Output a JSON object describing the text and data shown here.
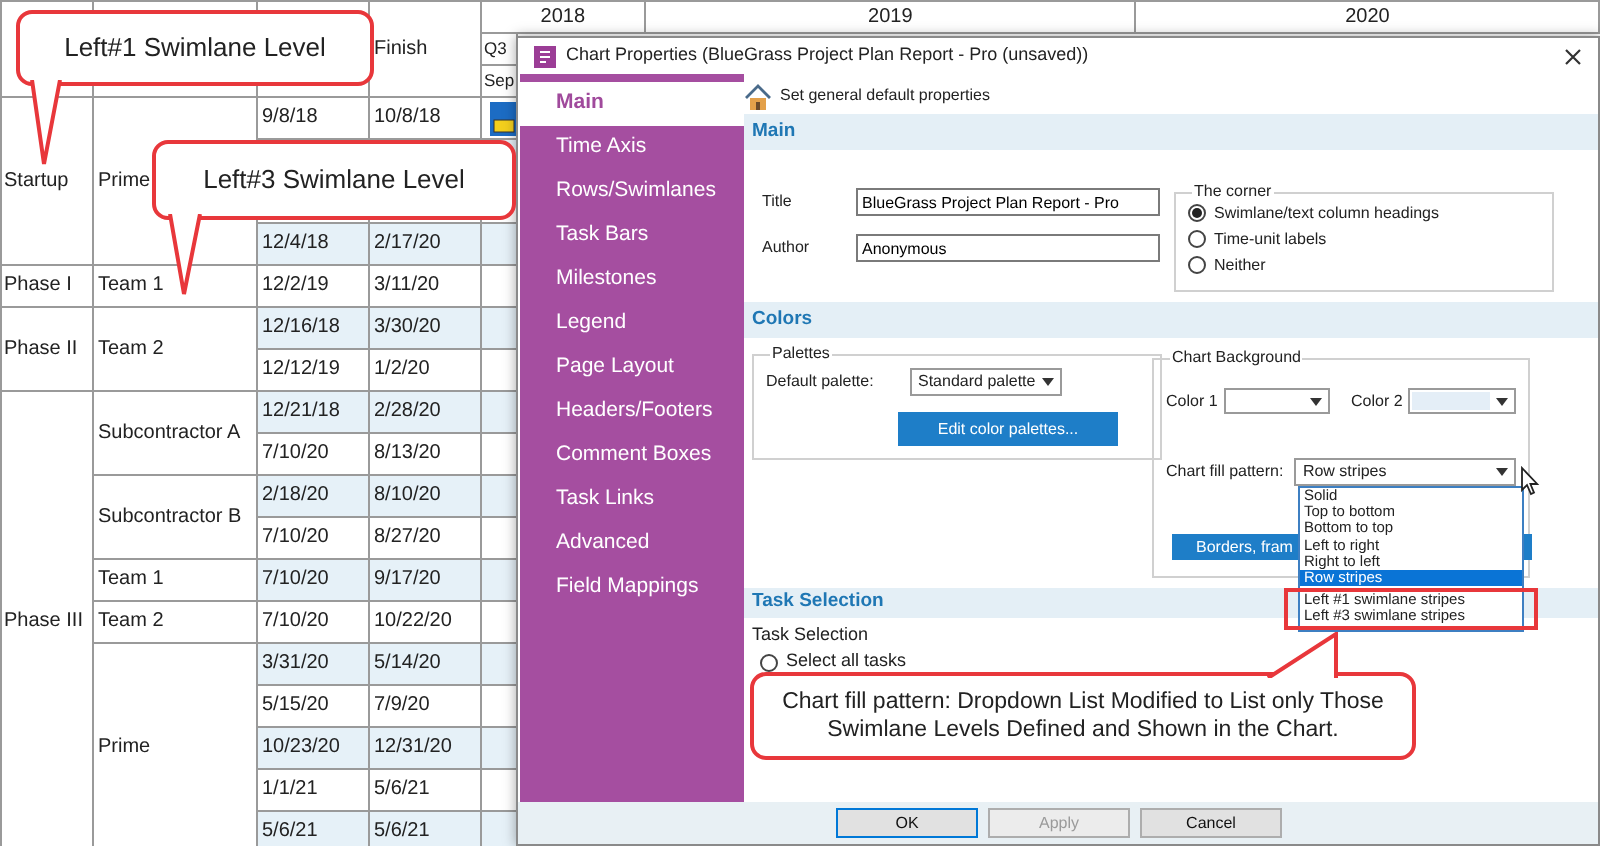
{
  "gantt": {
    "headings": {
      "finish": "Finish"
    },
    "timeline": {
      "years": [
        "2018",
        "2019",
        "2020"
      ],
      "quarters": [
        "Q3"
      ],
      "months": [
        "Sep"
      ]
    },
    "lanes": [
      {
        "label": "Startup",
        "groups": [
          {
            "label": "Prime",
            "tasks": [
              {
                "kind": "task",
                "start": "9/8/18",
                "finish": "10/8/18",
                "bar": true
              },
              {
                "kind": "covered"
              },
              {
                "kind": "covered"
              },
              {
                "kind": "task",
                "start": "12/4/18",
                "finish": "2/17/20"
              }
            ]
          }
        ]
      },
      {
        "label": "Phase I",
        "groups": [
          {
            "label": "Team 1",
            "tasks": [
              {
                "kind": "task",
                "start": "12/2/19",
                "finish": "3/11/20"
              }
            ]
          }
        ]
      },
      {
        "label": "Phase II",
        "groups": [
          {
            "label": "Team 2",
            "tasks": [
              {
                "kind": "task",
                "start": "12/16/18",
                "finish": "3/30/20"
              },
              {
                "kind": "task",
                "start": "12/12/19",
                "finish": "1/2/20"
              }
            ]
          }
        ]
      },
      {
        "label": "Phase III",
        "groups": [
          {
            "label": "Subcontractor A",
            "tasks": [
              {
                "kind": "task",
                "start": "12/21/18",
                "finish": "2/28/20"
              },
              {
                "kind": "task",
                "start": "7/10/20",
                "finish": "8/13/20"
              }
            ]
          },
          {
            "label": "Subcontractor B",
            "tasks": [
              {
                "kind": "task",
                "start": "2/18/20",
                "finish": "8/10/20"
              },
              {
                "kind": "task",
                "start": "7/10/20",
                "finish": "8/27/20"
              }
            ]
          },
          {
            "label": "Team 1",
            "tasks": [
              {
                "kind": "task",
                "start": "7/10/20",
                "finish": "9/17/20"
              }
            ]
          },
          {
            "label": "Team 2",
            "tasks": [
              {
                "kind": "task",
                "start": "7/10/20",
                "finish": "10/22/20"
              }
            ]
          },
          {
            "label": "Prime",
            "tasks": [
              {
                "kind": "task",
                "start": "3/31/20",
                "finish": "5/14/20"
              },
              {
                "kind": "task",
                "start": "5/15/20",
                "finish": "7/9/20"
              },
              {
                "kind": "task",
                "start": "10/23/20",
                "finish": "12/31/20"
              },
              {
                "kind": "task",
                "start": "1/1/21",
                "finish": "5/6/21"
              },
              {
                "kind": "task",
                "start": "5/6/21",
                "finish": "5/6/21"
              }
            ]
          }
        ]
      }
    ]
  },
  "dialog": {
    "title": "Chart Properties (BlueGrass Project Plan Report - Pro (unsaved))",
    "sidebar": [
      {
        "label": "Main",
        "selected": true
      },
      {
        "label": "Time Axis",
        "selected": false
      },
      {
        "label": "Rows/Swimlanes",
        "selected": false
      },
      {
        "label": "Task Bars",
        "selected": false
      },
      {
        "label": "Milestones",
        "selected": false
      },
      {
        "label": "Legend",
        "selected": false
      },
      {
        "label": "Page Layout",
        "selected": false
      },
      {
        "label": "Headers/Footers",
        "selected": false
      },
      {
        "label": "Comment Boxes",
        "selected": false
      },
      {
        "label": "Task Links",
        "selected": false
      },
      {
        "label": "Advanced",
        "selected": false
      },
      {
        "label": "Field Mappings",
        "selected": false
      }
    ],
    "subtitle": "Set general default properties",
    "main": {
      "heading": "Main",
      "title_label": "Title",
      "title_value": "BlueGrass Project Plan Report - Pro",
      "author_label": "Author",
      "author_value": "Anonymous",
      "corner": {
        "label": "The corner",
        "options": [
          {
            "label": "Swimlane/text column headings",
            "selected": true
          },
          {
            "label": "Time-unit labels",
            "selected": false
          },
          {
            "label": "Neither",
            "selected": false
          }
        ]
      }
    },
    "colors": {
      "heading": "Colors",
      "palettes": {
        "label": "Palettes",
        "default_palette_label": "Default palette:",
        "default_palette": "Standard palette",
        "edit_button": "Edit color palettes..."
      },
      "chart_background": {
        "label": "Chart Background",
        "color_1_label": "Color 1",
        "color_2_label": "Color 2",
        "fill_pattern_label": "Chart fill pattern:",
        "fill_pattern": "Row stripes",
        "borders_button": "Borders, fram",
        "fill_pattern_options": [
          {
            "label": "Solid",
            "selected": false,
            "highlighted": false
          },
          {
            "label": "Top to bottom",
            "selected": false,
            "highlighted": false
          },
          {
            "label": "Bottom to top",
            "selected": false,
            "highlighted": false
          },
          {
            "label": "Left to right",
            "selected": false,
            "highlighted": false
          },
          {
            "label": "Right to left",
            "selected": false,
            "highlighted": false
          },
          {
            "label": "Row stripes",
            "selected": true,
            "highlighted": false
          },
          {
            "label": "Left #1 swimlane stripes",
            "selected": false,
            "highlighted": true
          },
          {
            "label": "Left #3 swimlane stripes",
            "selected": false,
            "highlighted": true
          }
        ]
      }
    },
    "task_selection": {
      "heading": "Task Selection",
      "label": "Task Selection",
      "options": [
        {
          "label": "Select all tasks",
          "selected": false
        }
      ]
    },
    "buttons": [
      {
        "label": "OK",
        "focused": true,
        "disabled": false
      },
      {
        "label": "Apply",
        "focused": false,
        "disabled": true
      },
      {
        "label": "Cancel",
        "focused": false,
        "disabled": false
      }
    ]
  },
  "callouts": [
    {
      "text": "Left#1 Swimlane Level"
    },
    {
      "text": "Left#3 Swimlane Level"
    },
    {
      "text": "Chart fill pattern: Dropdown List Modified to List only Those Swimlane Levels Defined and Shown in the Chart."
    }
  ]
}
